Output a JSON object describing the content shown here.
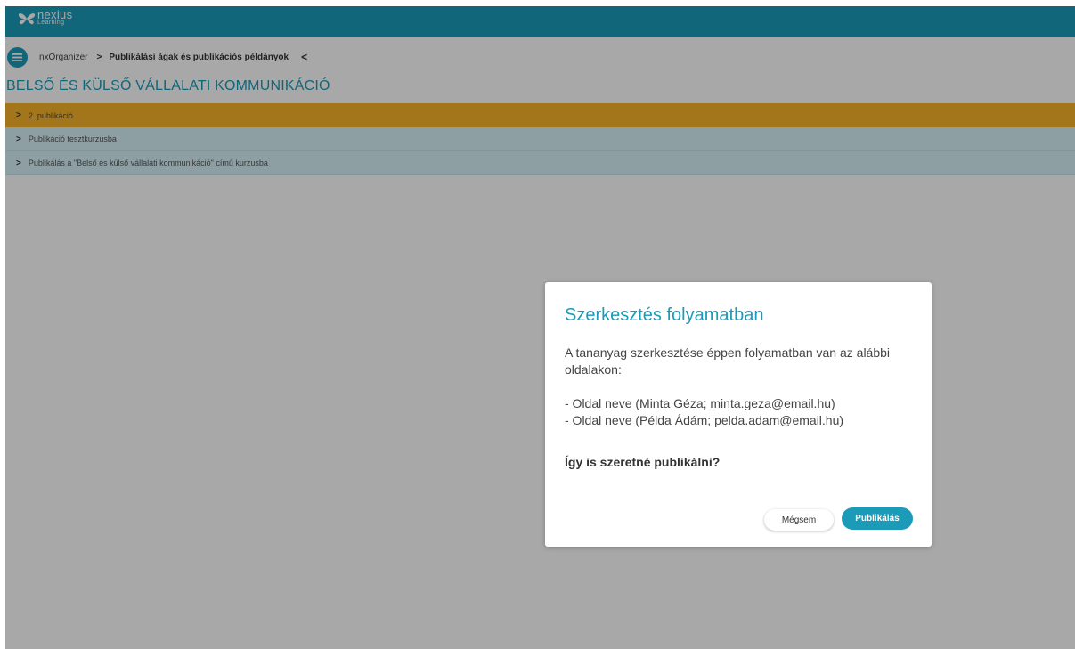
{
  "brand": {
    "name": "nexius",
    "sub": "Learning"
  },
  "breadcrumb": {
    "root": "nxOrganizer",
    "separator": ">",
    "current": "Publikálási ágak és publikációs példányok",
    "back": "<"
  },
  "page": {
    "title": "BELSŐ ÉS KÜLSŐ VÁLLALATI KOMMUNIKÁCIÓ"
  },
  "rows": [
    {
      "label": "2. publikáció",
      "active": true
    },
    {
      "label": "Publikáció tesztkurzusba",
      "active": false
    },
    {
      "label": "Publikálás a \"Belső és külső vállalati kommunikáció\" című kurzusba",
      "active": false
    }
  ],
  "dialog": {
    "title": "Szerkesztés folyamatban",
    "message": "A tananyag szerkesztése éppen folyamatban van az alábbi oldalakon:",
    "pages": [
      "- Oldal neve (Minta Géza; minta.geza@email.hu)",
      "- Oldal neve (Példa Ádám; pelda.adam@email.hu)"
    ],
    "question": "Így is szeretné publikálni?",
    "cancel_label": "Mégsem",
    "confirm_label": "Publikálás"
  },
  "colors": {
    "accent": "#1b9bb8",
    "active_row": "#f7b32b",
    "row": "#d6f1f6"
  },
  "icons": {
    "menu": "hamburger-menu-icon",
    "chevron_right": "chevron-right-icon",
    "chevron_left": "chevron-left-icon",
    "logo": "butterfly-logo-icon"
  }
}
